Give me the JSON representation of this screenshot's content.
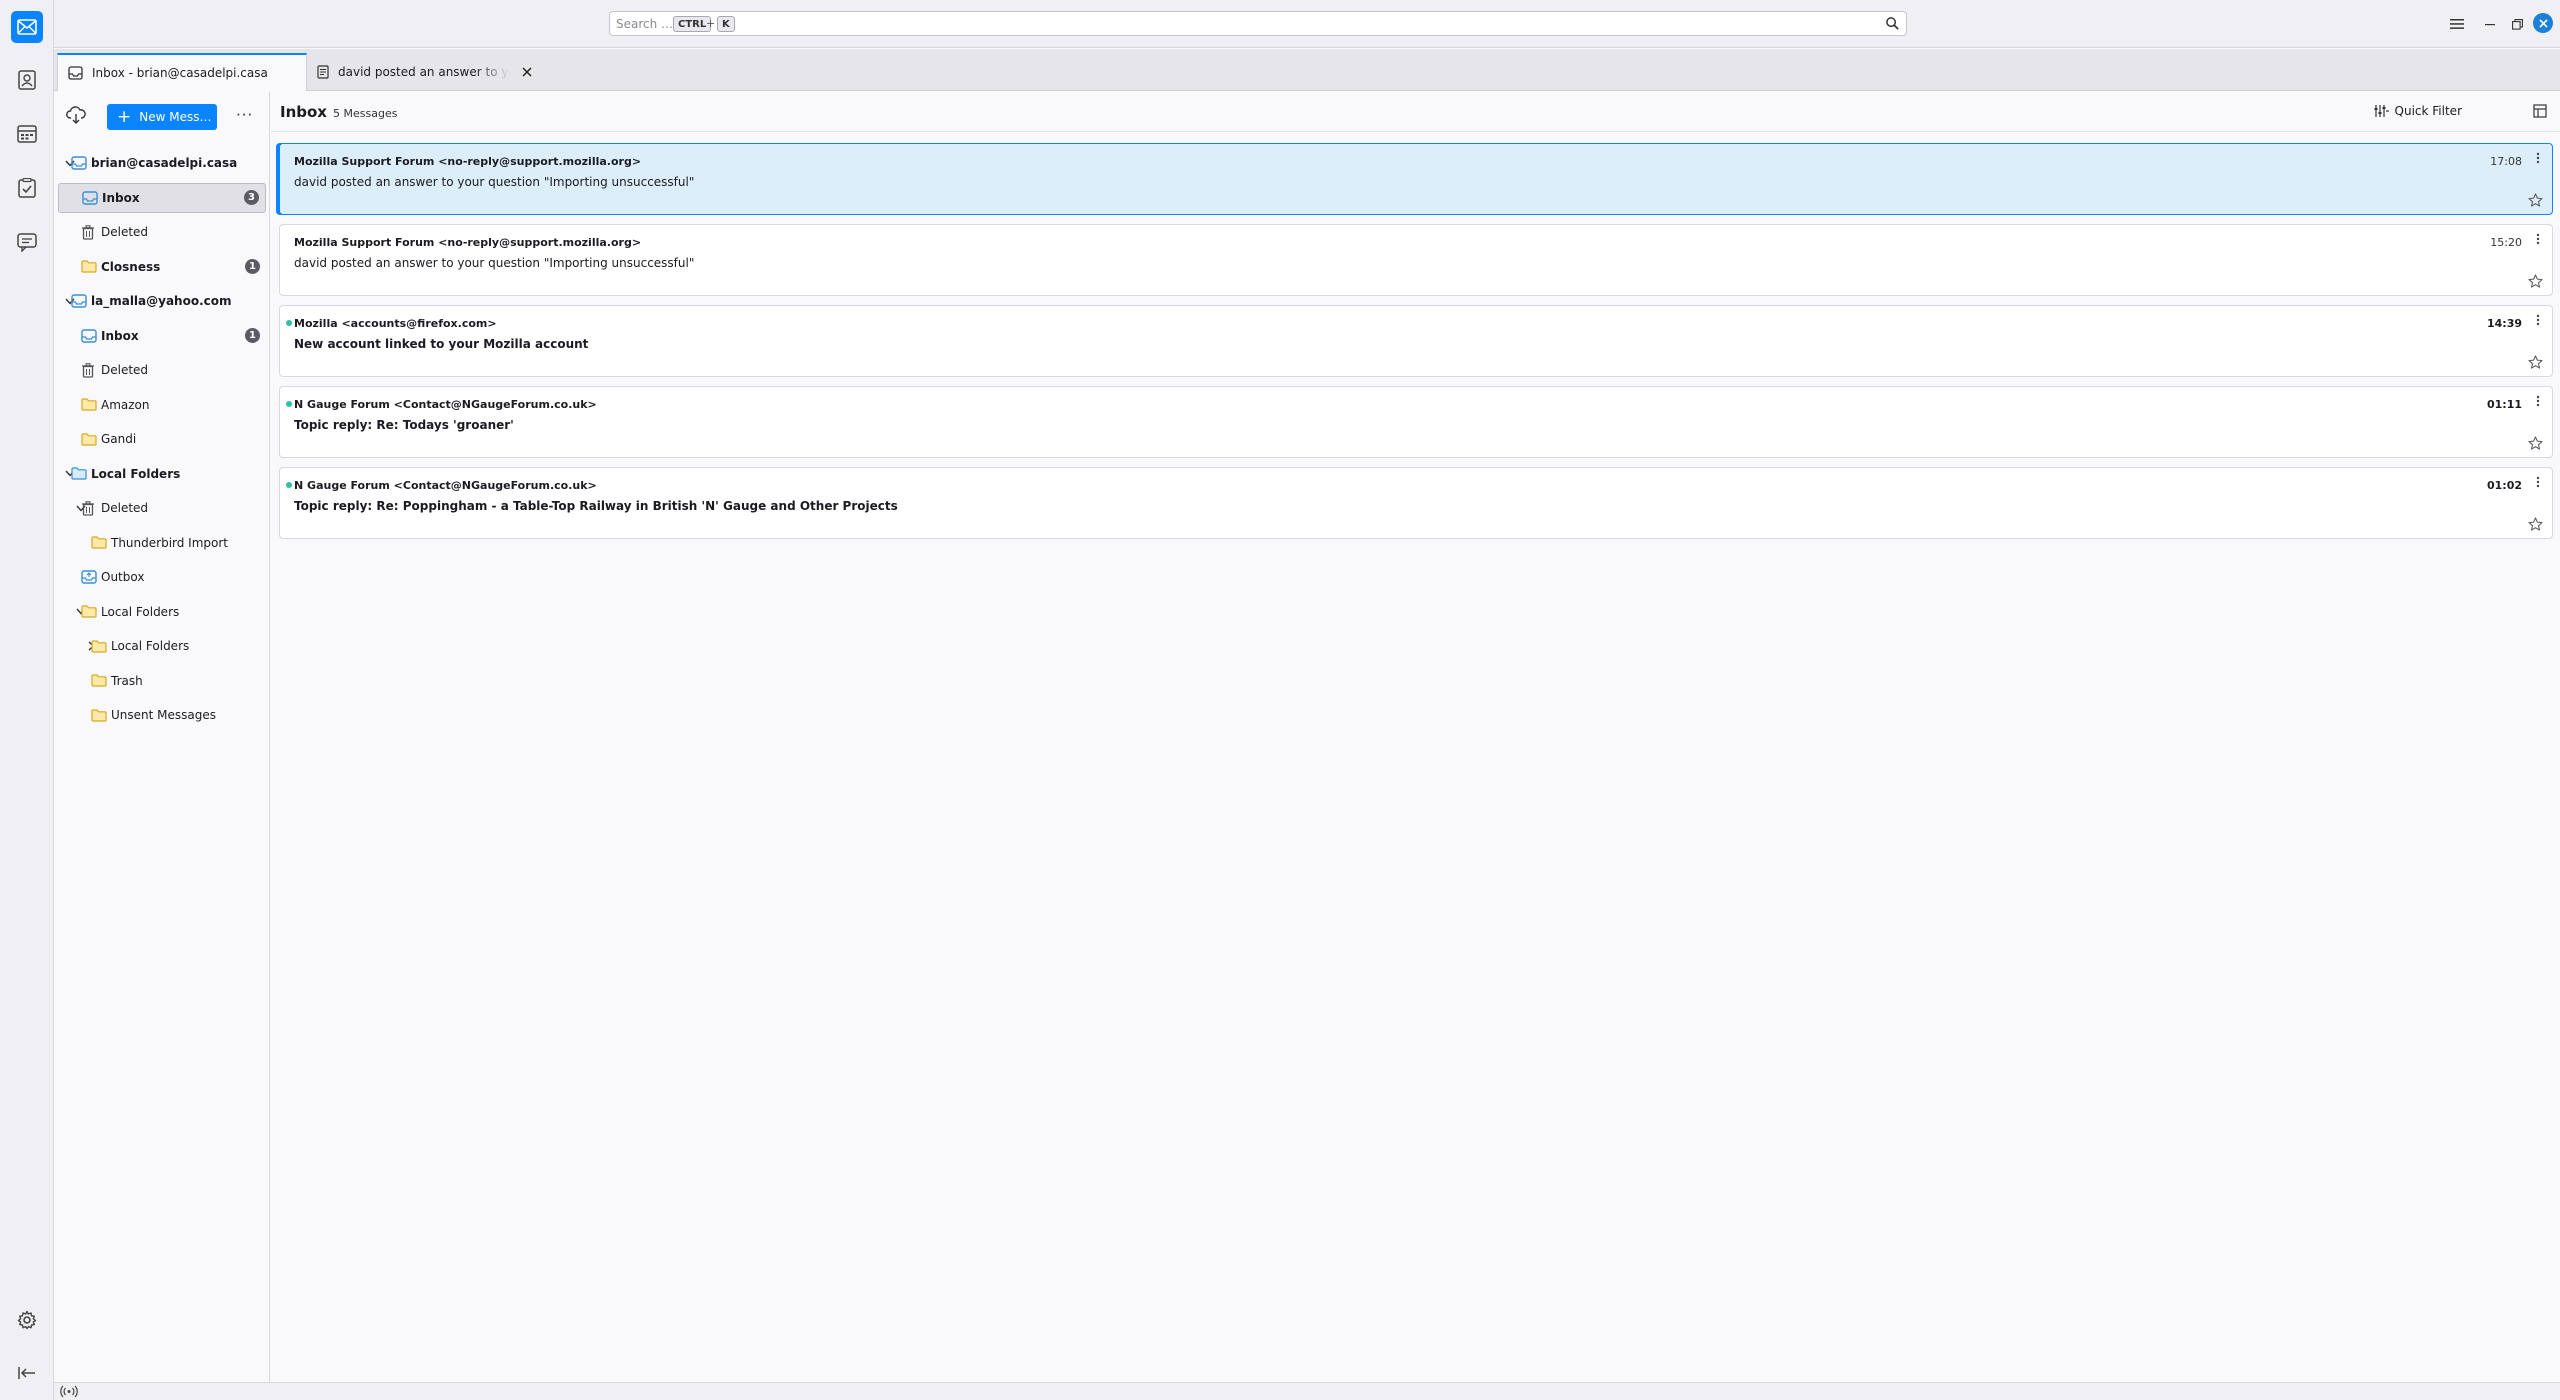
{
  "search": {
    "placeholder": "Search …",
    "shortcut_key1": "CTRL",
    "shortcut_plus": "+",
    "shortcut_key2": "K"
  },
  "tabs": [
    {
      "label": "Inbox - brian@casadelpi.casa",
      "active": true,
      "icon": "inbox-icon"
    },
    {
      "label": "david posted an answer to your qu",
      "active": false,
      "icon": "message-icon"
    }
  ],
  "folder_pane": {
    "new_message_label": "New Mess…",
    "more_label": "···"
  },
  "folders": [
    {
      "label": "brian@casadelpi.casa",
      "level": 0,
      "bold": true,
      "icon": "account-icon",
      "twisty": "down"
    },
    {
      "label": "Inbox",
      "level": 1,
      "bold": true,
      "icon": "inbox-icon",
      "badge": "3",
      "selected": true
    },
    {
      "label": "Deleted",
      "level": 1,
      "icon": "trash-icon"
    },
    {
      "label": "Closness",
      "level": 1,
      "bold": true,
      "icon": "folder-icon",
      "badge": "1"
    },
    {
      "label": "la_malla@yahoo.com",
      "level": 0,
      "bold": true,
      "icon": "account-icon",
      "twisty": "down"
    },
    {
      "label": "Inbox",
      "level": 1,
      "bold": true,
      "icon": "inbox-icon",
      "badge": "1"
    },
    {
      "label": "Deleted",
      "level": 1,
      "icon": "trash-icon"
    },
    {
      "label": "Amazon",
      "level": 1,
      "icon": "folder-icon"
    },
    {
      "label": "Gandi",
      "level": 1,
      "icon": "folder-icon"
    },
    {
      "label": "Local Folders",
      "level": 0,
      "bold": true,
      "icon": "local-folders-icon",
      "twisty": "down"
    },
    {
      "label": "Deleted",
      "level": 1,
      "icon": "trash-icon",
      "twisty": "down"
    },
    {
      "label": "Thunderbird Import",
      "level": 2,
      "icon": "folder-icon"
    },
    {
      "label": "Outbox",
      "level": 1,
      "icon": "outbox-icon"
    },
    {
      "label": "Local Folders",
      "level": 1,
      "icon": "folder-icon",
      "twisty": "down"
    },
    {
      "label": "Local Folders",
      "level": 2,
      "icon": "folder-icon",
      "twisty": "right"
    },
    {
      "label": "Trash",
      "level": 2,
      "icon": "folder-icon"
    },
    {
      "label": "Unsent Messages",
      "level": 2,
      "icon": "folder-icon"
    }
  ],
  "message_list": {
    "title": "Inbox",
    "count": "5 Messages",
    "quick_filter_label": "Quick Filter"
  },
  "messages": [
    {
      "sender": "Mozilla Support Forum <no-reply@support.mozilla.org>",
      "subject": "david posted an answer to your question \"Importing unsuccessful\"",
      "time": "17:08",
      "unread": false,
      "selected": true
    },
    {
      "sender": "Mozilla Support Forum <no-reply@support.mozilla.org>",
      "subject": "david posted an answer to your question \"Importing unsuccessful\"",
      "time": "15:20",
      "unread": false,
      "selected": false
    },
    {
      "sender": "Mozilla <accounts@firefox.com>",
      "subject": "New account linked to your Mozilla account",
      "time": "14:39",
      "unread": true,
      "selected": false
    },
    {
      "sender": "N Gauge Forum <Contact@NGaugeForum.co.uk>",
      "subject": "Topic reply: Re: Todays 'groaner'",
      "time": "01:11",
      "unread": true,
      "selected": false
    },
    {
      "sender": "N Gauge Forum <Contact@NGaugeForum.co.uk>",
      "subject": "Topic reply: Re: Poppingham - a Table-Top Railway in British 'N' Gauge and Other Projects",
      "time": "01:02",
      "unread": true,
      "selected": false
    }
  ],
  "colors": {
    "accent": "#0a84ff",
    "selected_row": "#dceefa",
    "unread_dot": "#2ac3a2",
    "folder_yellow": "#f5c444",
    "badge": "#5b5b66"
  }
}
